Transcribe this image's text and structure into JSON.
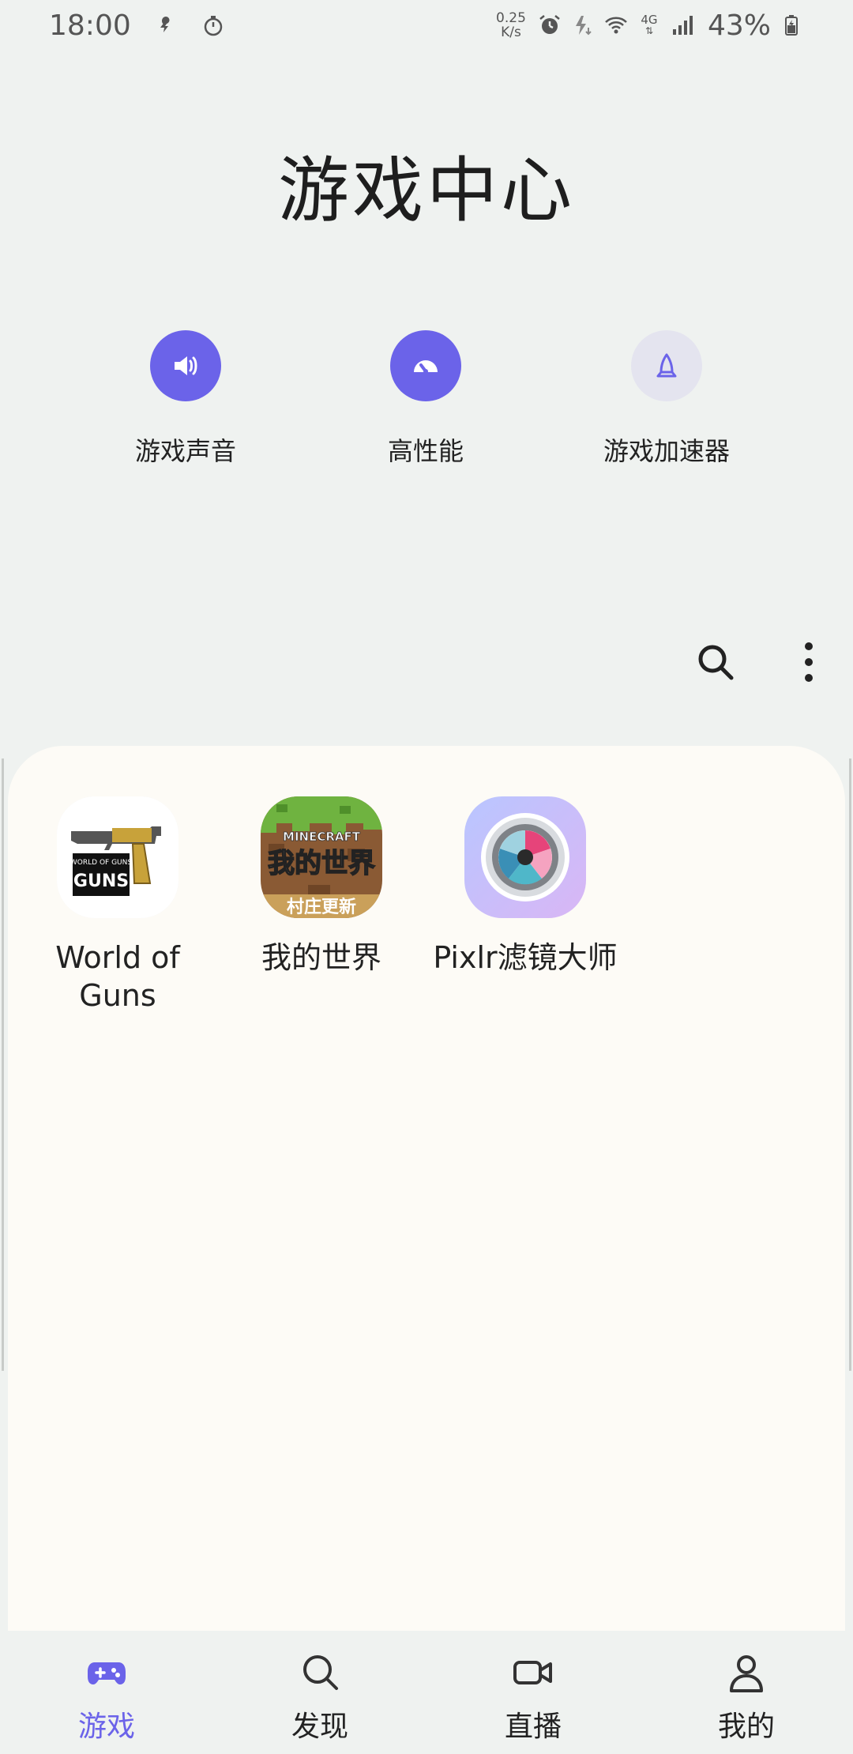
{
  "status_bar": {
    "time": "18:00",
    "net_speed_value": "0.25",
    "net_speed_unit": "K/s",
    "network_type": "4G",
    "battery": "43%"
  },
  "page": {
    "title": "游戏中心"
  },
  "quick_actions": [
    {
      "label": "游戏声音",
      "icon": "speaker-icon",
      "active": true
    },
    {
      "label": "高性能",
      "icon": "speedometer-icon",
      "active": true
    },
    {
      "label": "游戏加速器",
      "icon": "rocket-icon",
      "active": false
    }
  ],
  "games": [
    {
      "name": "World of Guns",
      "icon": "world-of-guns-app-icon",
      "icon_text": "WORLD OF GUNS"
    },
    {
      "name": "我的世界",
      "icon": "minecraft-app-icon",
      "icon_text": "MINECRAFT 我的世界 村庄更新"
    },
    {
      "name": "Pixlr滤镜大师",
      "icon": "pixlr-app-icon"
    }
  ],
  "bottom_nav": [
    {
      "label": "游戏",
      "icon": "gamepad-icon",
      "active": true
    },
    {
      "label": "发现",
      "icon": "search-icon",
      "active": false
    },
    {
      "label": "直播",
      "icon": "video-camera-icon",
      "active": false
    },
    {
      "label": "我的",
      "icon": "person-icon",
      "active": false
    }
  ],
  "colors": {
    "accent": "#6b63e9",
    "background": "#eff2f0",
    "panel": "#fdfbf6"
  }
}
